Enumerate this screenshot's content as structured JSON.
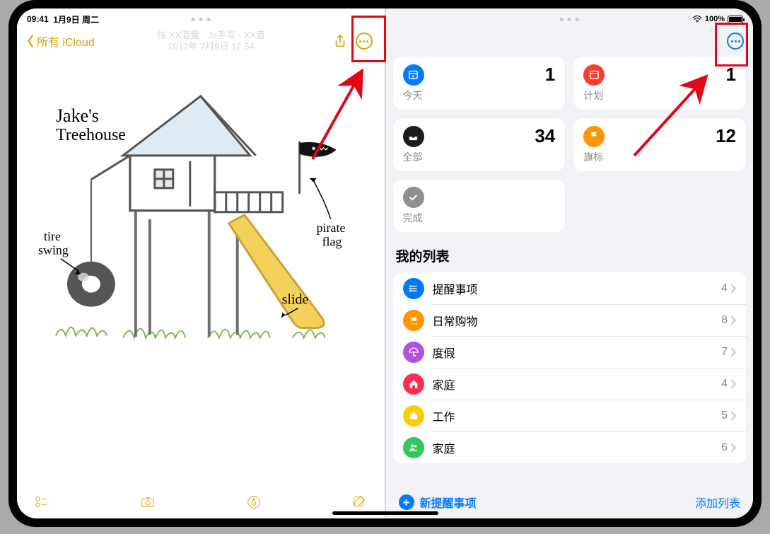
{
  "status_left": {
    "time": "09:41",
    "date": "1月9日 周二"
  },
  "status_right": {
    "battery_pct": "100%"
  },
  "notes": {
    "back_label": "所有 iCloud",
    "title_l1": "技 XX酒量 · Je手写 · XX音",
    "title_l2": "2012年 7月9日 12:54",
    "annotations": {
      "title_main": "Jake's",
      "title_sub": "Treehouse",
      "tire_l1": "tire",
      "tire_l2": "swing",
      "slide": "slide",
      "pirate_l1": "pirate",
      "pirate_l2": "flag"
    }
  },
  "reminders": {
    "cards": {
      "today": {
        "label": "今天",
        "count": "1"
      },
      "scheduled": {
        "label": "计划",
        "count": "1"
      },
      "all": {
        "label": "全部",
        "count": "34"
      },
      "flagged": {
        "label": "旗标",
        "count": "12"
      },
      "done": {
        "label": "完成",
        "count": ""
      }
    },
    "section_title": "我的列表",
    "lists": [
      {
        "name": "提醒事项",
        "count": "4",
        "color": "#007aff",
        "icon": "list"
      },
      {
        "name": "日常购物",
        "count": "8",
        "color": "#ff9500",
        "icon": "cart"
      },
      {
        "name": "度假",
        "count": "7",
        "color": "#af52de",
        "icon": "umbrella"
      },
      {
        "name": "家庭",
        "count": "4",
        "color": "#ff2d55",
        "icon": "house"
      },
      {
        "name": "工作",
        "count": "5",
        "color": "#ffcc00",
        "icon": "briefcase"
      },
      {
        "name": "家庭",
        "count": "6",
        "color": "#34c759",
        "icon": "people"
      }
    ],
    "footer": {
      "new": "新提醒事项",
      "add_list": "添加列表"
    }
  }
}
